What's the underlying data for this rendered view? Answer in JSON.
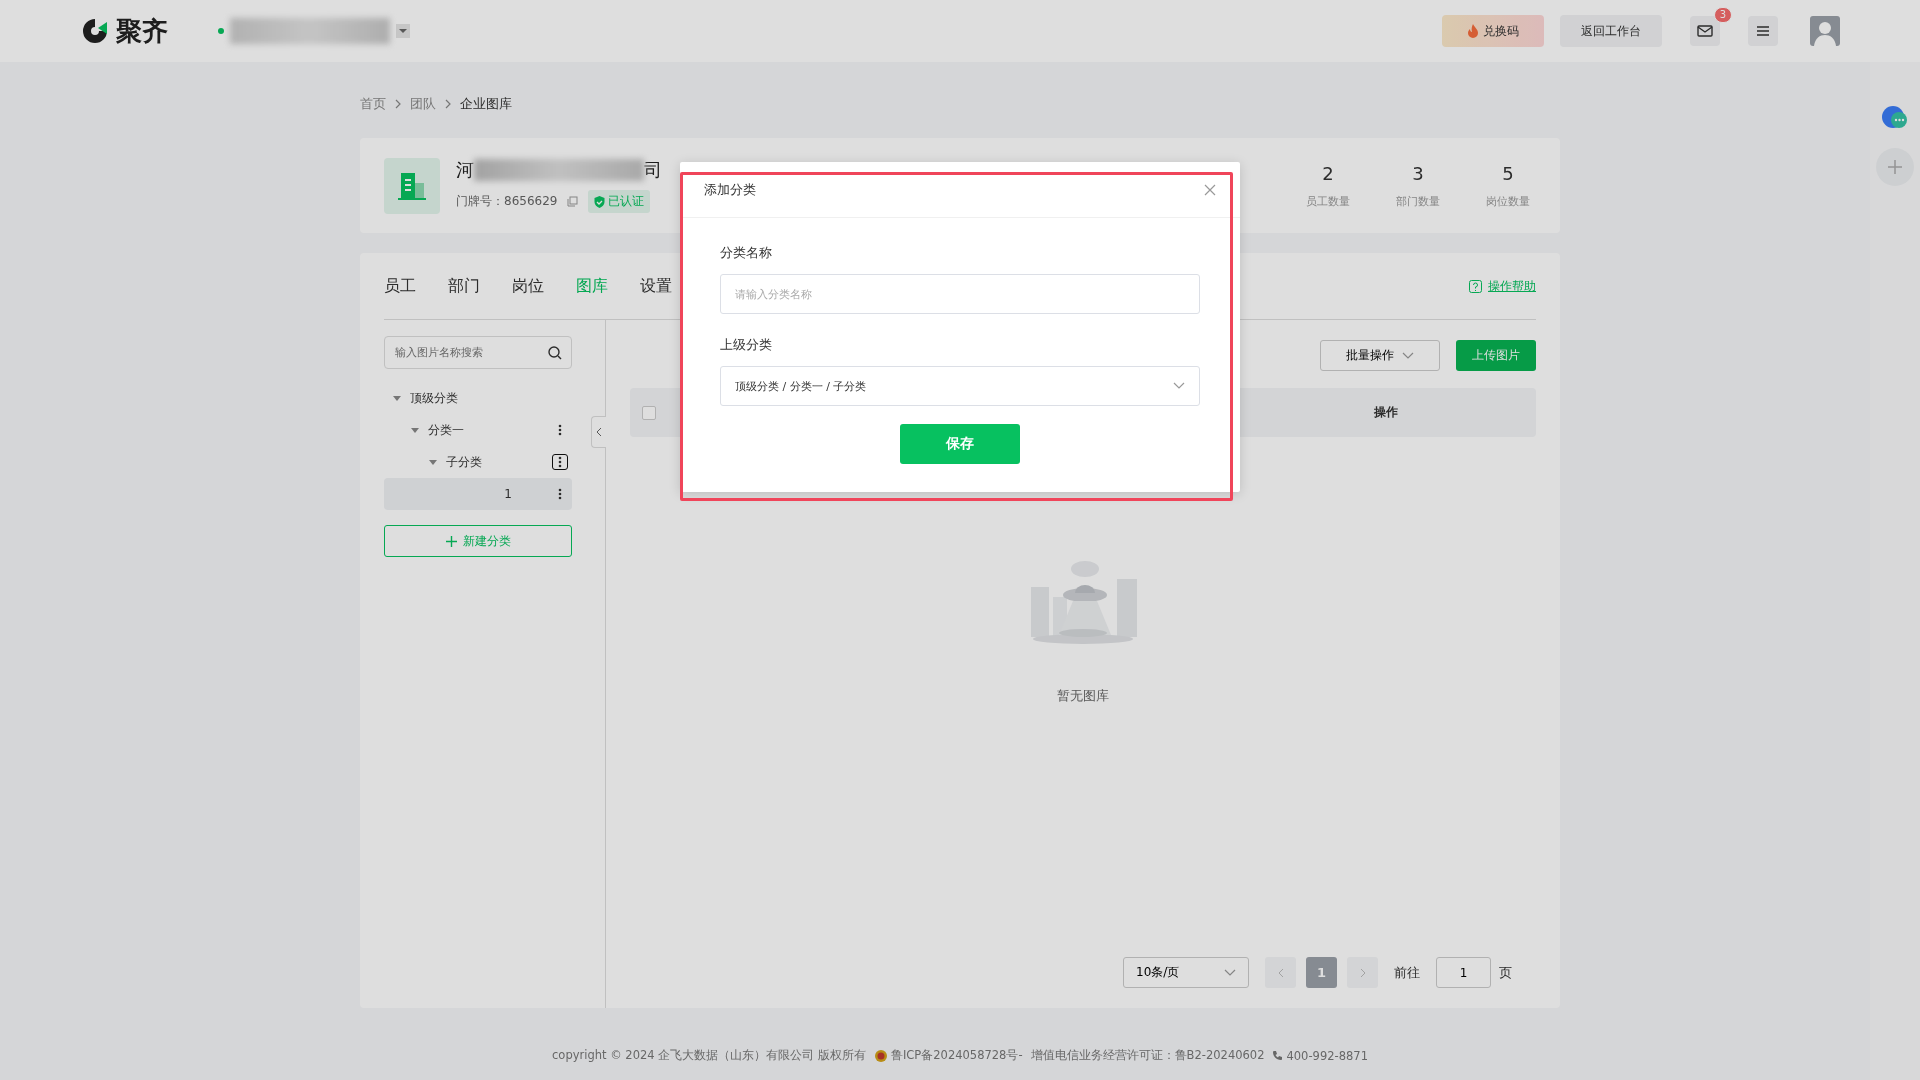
{
  "topbar": {
    "logo_text": "聚齐",
    "redeem_button": "兑换码",
    "workbench_button": "返回工作台",
    "mail_badge": "3"
  },
  "breadcrumb": [
    {
      "label": "首页",
      "current": false
    },
    {
      "label": "团队",
      "current": false
    },
    {
      "label": "企业图库",
      "current": true
    }
  ],
  "company": {
    "name_start": "河",
    "name_end": "司",
    "door_label": "门牌号：8656629",
    "verified": "已认证",
    "stats": [
      {
        "value": "2",
        "label": "员工数量"
      },
      {
        "value": "3",
        "label": "部门数量"
      },
      {
        "value": "5",
        "label": "岗位数量"
      }
    ]
  },
  "tabs": [
    {
      "label": "员工",
      "selected": false
    },
    {
      "label": "部门",
      "selected": false
    },
    {
      "label": "岗位",
      "selected": false
    },
    {
      "label": "图库",
      "selected": true
    },
    {
      "label": "设置",
      "selected": false
    }
  ],
  "help_link": "操作帮助",
  "search": {
    "placeholder": "输入图片名称搜索"
  },
  "tree": [
    {
      "label": "顶级分类",
      "expanded": true,
      "selected": false,
      "children": [
        {
          "label": "分类一",
          "expanded": true,
          "selected": false,
          "focused": false,
          "children": [
            {
              "label": "子分类",
              "expanded": true,
              "selected": false,
              "focused": true,
              "children": [
                {
                  "label": "1",
                  "expanded": false,
                  "selected": true,
                  "focused": false
                }
              ]
            }
          ]
        }
      ]
    }
  ],
  "new_category_button": "新建分类",
  "toolbar": {
    "batch_button": "批量操作",
    "upload_button": "上传图片"
  },
  "table": {
    "header_checked": false,
    "columns": [
      "操作"
    ]
  },
  "empty_text": "暂无图库",
  "pagination": {
    "page_size": "10条/页",
    "pages": [
      {
        "label": "1",
        "selected": true
      }
    ],
    "goto_label": "前往",
    "goto_value": "1",
    "page_suffix": "页"
  },
  "footer": {
    "copyright": "copyright © 2024 企飞大数据（山东）有限公司 版权所有",
    "icp": "鲁ICP备2024058728号-",
    "license": "增值电信业务经营许可证：鲁B2-20240602",
    "phone": "400-992-8871"
  },
  "modal": {
    "title": "添加分类",
    "fields": [
      {
        "kind": "input",
        "label": "分类名称",
        "placeholder": "请输入分类名称"
      },
      {
        "kind": "select",
        "label": "上级分类",
        "value": "顶级分类 / 分类一 / 子分类"
      }
    ],
    "save_button": "保存"
  }
}
